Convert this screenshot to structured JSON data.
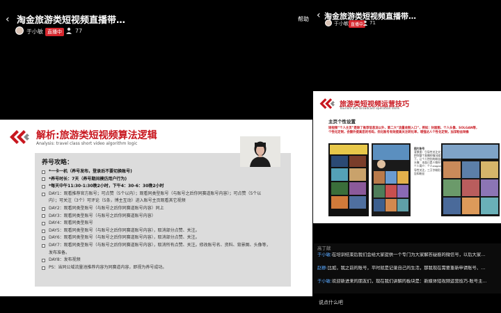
{
  "left": {
    "title": "淘金旅游类短视频直播带…",
    "help": "帮助",
    "host": "于小敏",
    "badge": "直播中",
    "viewers": "77",
    "slide": {
      "title": "解析:旅游类短视频算法逻辑",
      "subtitle": "Analysis: travel class short video algorithm logic",
      "panel_title": "养号攻略：",
      "lines": [
        "*一卡一机（养号发布，登录后不要切换账号)",
        "*养号时长：7天（养号期间模仿用户行为)",
        "*每天中午11:30-1:30晚2小时，下午4：30-6：30晚2小时",
        "DAY1：观看推荐官方账号；可点赞（5个以内）；观看同类型账号（与账号之后你同赛道账号内容）；可点赞（5个以",
        "内）；可关注（3个）可评论（5条，博主互动）进入账号主页观看其它视频",
        "DAY2：观看同类型账号（与账号之后你同赛道账号内容）同上",
        "DAY3：观看同类型账号（与账号之后你同赛道账号内容）",
        "DAY4：观看同类型账号",
        "DAY5：观看同类型账号（与账号之后你同赛道账号内容），取消部分点赞、关注。",
        "DAY6：观看同类型账号（与账号之后你同赛道账号内容），取消部分点赞、关注。",
        "DAY7：观看同类型账号（与账号之后你同赛道账号内容），取消所有点赞、关注。修改账号名、资料、背景图、头像等，",
        "发布准备。",
        "DAY8：发布视频",
        "PS：当同公域流量池推荐内容为同赛道内容，即视为养号成功。"
      ]
    }
  },
  "right": {
    "title": "淘金旅游类短视频直播带…",
    "host": "于小敏",
    "badge": "直播中",
    "viewers": "71",
    "slide": {
      "title": "旅游类短视频运营技巧",
      "subtitle": "Tourism live broadcast operation skills",
      "section": "主页个性设置",
      "para1": "短视频“个人主页”是除了推荐信息流以外，第二大“流量收割入口”，例如：封面图、个人头像、SOLGAN等，",
      "para2": "个性化定制，会额外提高您的号码，优化账号有效提高关注转化率，增强达人个性化定制，加深粉丝映象",
      "info_lines": [
        "图片账号",
        "背景图：引导性关注文字、",
        "把你整个直播的情况描写一",
        "下，让个人特别的粉丝群。",
        "头像：本面已是人物外型；",
        "",
        "个人简介：个人slogan，引",
        "导性关注，三万字粉形式，",
        "告知粉丝"
      ]
    },
    "chat": {
      "header": "高丁献",
      "messages": [
        {
          "name": "于小敏:",
          "text": "在培训结束后我们会给大家提供一个专门为大家解答疑惑的微信号，以后大家…"
        },
        {
          "name": "赵静:",
          "text": "比如，我之前的账号，平时就是记录自己的生活，那我现在需要重新申请账号、…"
        },
        {
          "name": "于小敏:",
          "text": "欢迎新进来的朋友们，现在我们讲解的板块是：新媒体短视频运营技巧-账号主…"
        }
      ],
      "input_placeholder": "说点什么吧"
    }
  },
  "colors": {
    "brand_red": "#c8161e",
    "badge_red": "#d6262d",
    "chat_name": "#5aa9ff"
  }
}
